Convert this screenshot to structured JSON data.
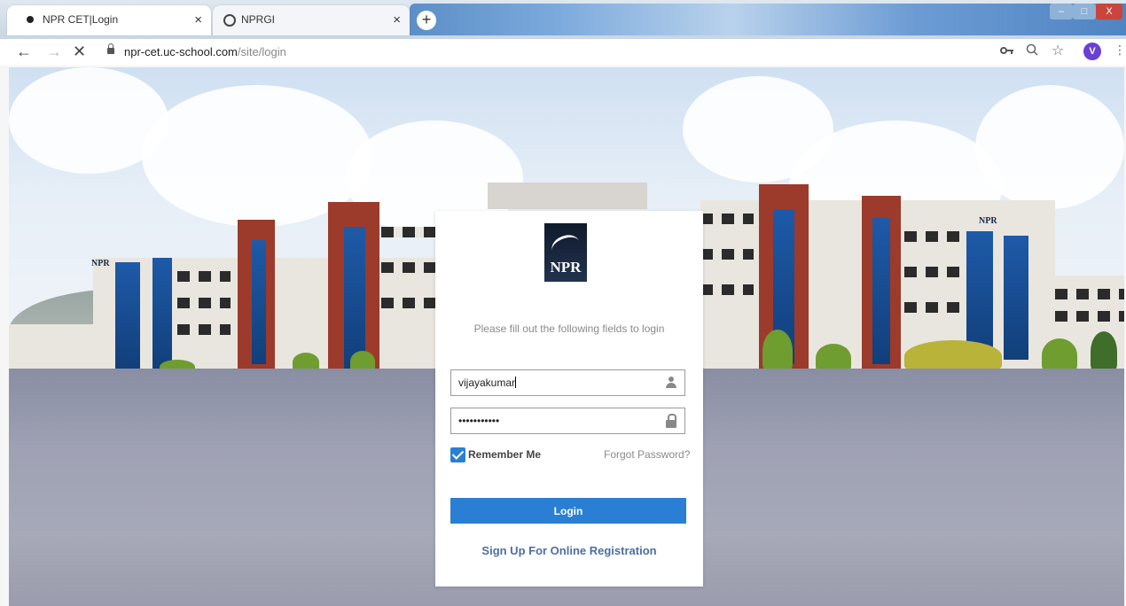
{
  "browser": {
    "tabs": [
      {
        "title": "NPR CET|Login",
        "close": "×"
      },
      {
        "title": "NPRGI",
        "close": "×"
      }
    ],
    "new_tab": "+",
    "window_controls": {
      "minimize": "–",
      "maximize": "□",
      "close": "X"
    },
    "nav": {
      "back": "←",
      "forward": "→",
      "stop": "✕"
    },
    "url_host": "npr-cet.uc-school.com",
    "url_path": "/site/login",
    "toolbar_icons": {
      "key": "key-icon",
      "zoom": "zoom-icon",
      "star": "☆",
      "menu": "⋮"
    },
    "profile_initial": "V"
  },
  "page": {
    "building_signs": [
      "NPR",
      "NPR"
    ]
  },
  "login": {
    "logo_text": "NPR",
    "instructions": "Please fill out the following fields to login",
    "username_value": "vijayakumar",
    "password_value": "•••••••••••",
    "remember_label": "Remember Me",
    "remember_checked": true,
    "forgot_label": "Forgot Password?",
    "login_button": "Login",
    "signup_link": "Sign Up For Online Registration"
  },
  "colors": {
    "accent": "#2a7fd4",
    "link": "#4d6fa3",
    "profile": "#6a3fd6"
  }
}
